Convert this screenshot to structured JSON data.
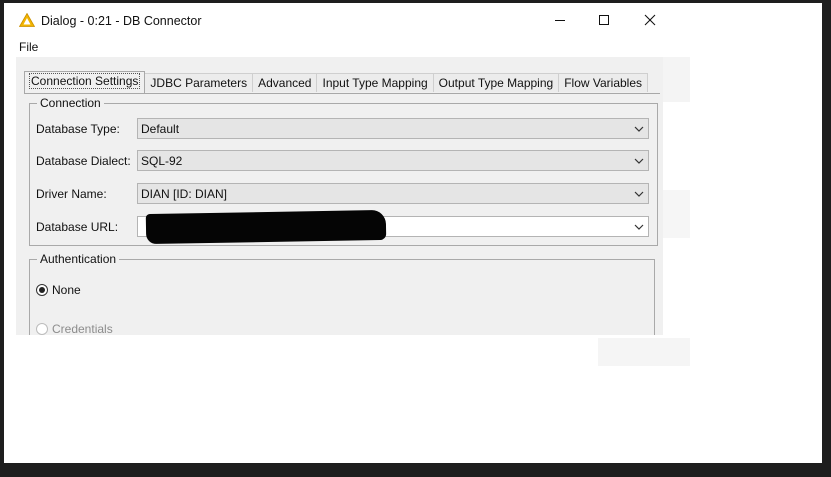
{
  "window": {
    "title": "Dialog - 0:21 - DB Connector",
    "icon": "warning-triangle-icon",
    "controls": [
      "minimize-icon",
      "maximize-icon",
      "close-icon"
    ]
  },
  "menu": {
    "file_label": "File"
  },
  "tabs": [
    {
      "label": "Connection Settings",
      "active": true
    },
    {
      "label": "JDBC Parameters"
    },
    {
      "label": "Advanced"
    },
    {
      "label": "Input Type Mapping"
    },
    {
      "label": "Output Type Mapping"
    },
    {
      "label": "Flow Variables"
    }
  ],
  "connection": {
    "group_label": "Connection",
    "database_type": {
      "label": "Database Type:",
      "value": "Default"
    },
    "database_dialect": {
      "label": "Database Dialect:",
      "value": "SQL-92"
    },
    "driver_name": {
      "label": "Driver Name:",
      "value": "DIAN [ID: DIAN]"
    },
    "database_url": {
      "label": "Database URL:",
      "value": ""
    }
  },
  "authentication": {
    "group_label": "Authentication",
    "options": [
      {
        "label": "None",
        "checked": true
      },
      {
        "label": "Credentials",
        "disabled": true
      }
    ]
  },
  "colors": {
    "accent_warning": "#f2b400",
    "panel_bg": "#f0f0f0",
    "frame": "#1e1e1e"
  }
}
